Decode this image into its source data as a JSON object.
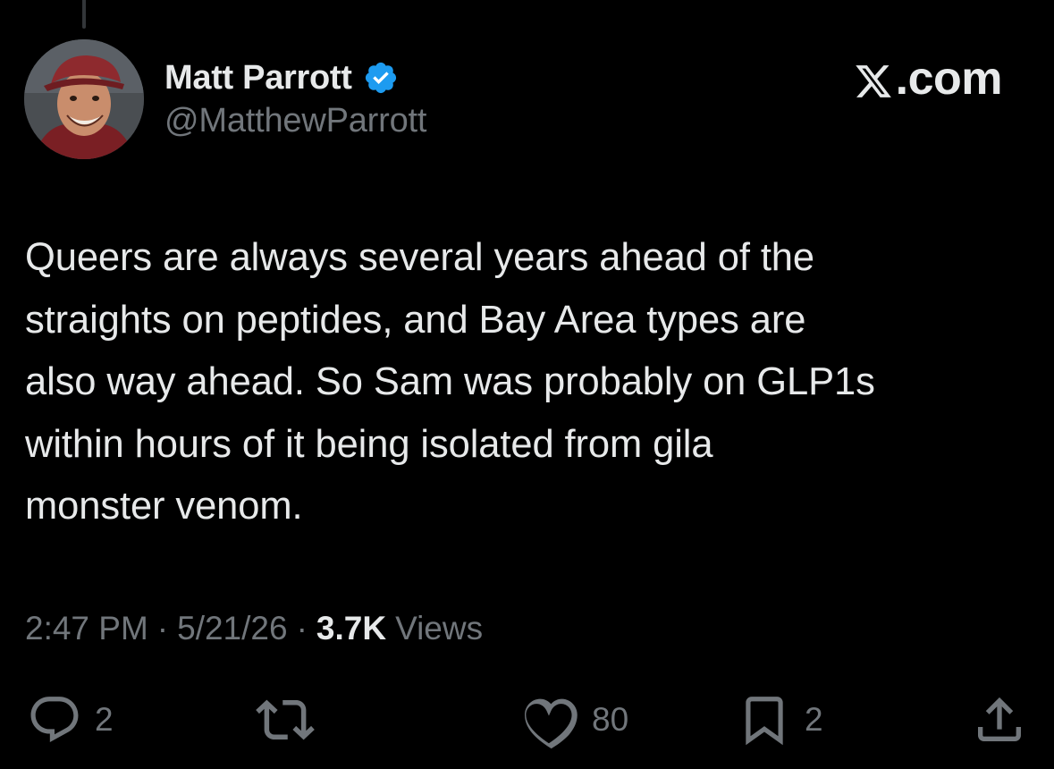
{
  "tweet": {
    "author": {
      "display_name": "Matt Parrott",
      "handle": "@MatthewParrott",
      "verified": true
    },
    "site_logo": {
      "icon": "x-logo-icon",
      "text": ".com"
    },
    "text_lines": [
      "Queers are always several years ahead of the",
      "straights on peptides, and Bay Area types are",
      "also way ahead. So Sam was probably on GLP1s",
      "within hours of it being isolated from gila",
      "monster venom."
    ],
    "meta": {
      "time": "2:47 PM",
      "separator": "·",
      "date": "5/21/26",
      "views_count": "3.7K",
      "views_label": "Views"
    },
    "actions": {
      "reply": {
        "icon": "reply-icon",
        "count": "2"
      },
      "repost": {
        "icon": "repost-icon",
        "count": ""
      },
      "like": {
        "icon": "heart-icon",
        "count": "80"
      },
      "bookmark": {
        "icon": "bookmark-icon",
        "count": "2"
      },
      "share": {
        "icon": "share-icon"
      }
    }
  },
  "colors": {
    "background": "#000000",
    "primary_text": "#e7e9ea",
    "secondary_text": "#71767b",
    "verified_blue": "#1d9bf0"
  }
}
